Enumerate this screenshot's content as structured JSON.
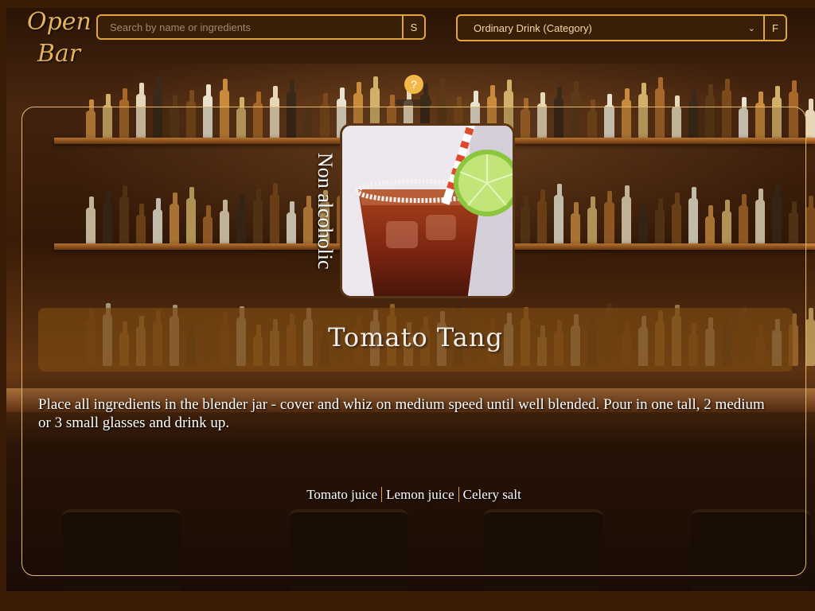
{
  "header": {
    "logo_line1": "Open",
    "logo_line2": "Bar",
    "search": {
      "placeholder": "Search by name or ingredients",
      "button_label": "S"
    },
    "category": {
      "selected": "Ordinary Drink (Category)",
      "button_label": "F"
    }
  },
  "help": {
    "label": "?"
  },
  "drink": {
    "alcoholic": "Non alcoholic",
    "name": "Tomato Tang",
    "instructions": "Place all ingredients in the blender jar - cover and whiz on medium speed until well blended. Pour in one tall, 2 medium or 3 small glasses and drink up.",
    "ingredients": [
      "Tomato juice",
      "Lemon juice",
      "Celery salt"
    ]
  },
  "colors": {
    "accent": "#e0a63c",
    "title_band": "#784812",
    "help_button": "#f2b84a"
  },
  "icons": {
    "select": "chevron-down-icon"
  }
}
